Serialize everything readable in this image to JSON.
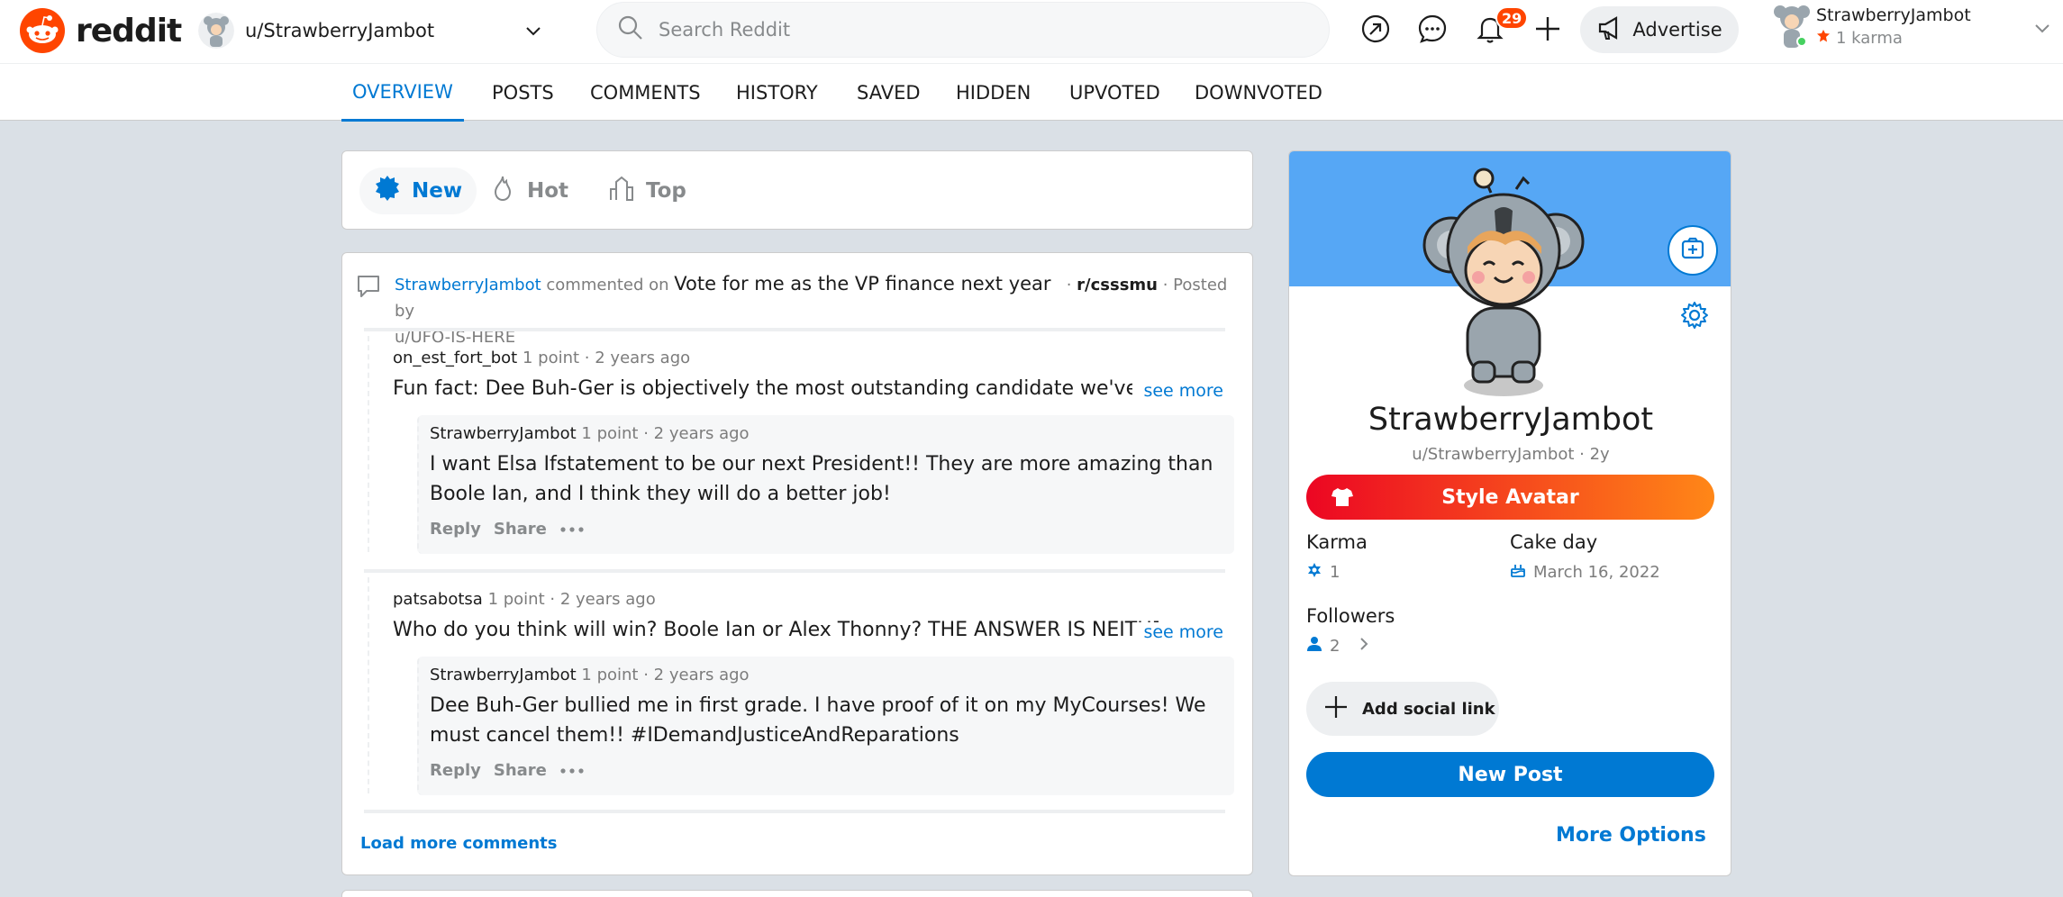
{
  "brand": {
    "wordmark": "reddit",
    "color": "#ff4500"
  },
  "context": {
    "label": "u/StrawberryJambot"
  },
  "search": {
    "placeholder": "Search Reddit"
  },
  "header": {
    "notifications_count": "29",
    "advertise_label": "Advertise"
  },
  "user": {
    "name": "StrawberryJambot",
    "karma": "1 karma"
  },
  "tabs": [
    "OVERVIEW",
    "POSTS",
    "COMMENTS",
    "HISTORY",
    "SAVED",
    "HIDDEN",
    "UPVOTED",
    "DOWNVOTED"
  ],
  "sort": {
    "new": "New",
    "hot": "Hot",
    "top": "Top"
  },
  "post": {
    "commenter": "StrawberryJambot",
    "action": "commented on",
    "title": "Vote for me as the VP finance next year",
    "subreddit": "r/csssmu",
    "posted_by": "· Posted by",
    "author": "u/UFO-IS-HERE"
  },
  "comments": [
    {
      "author": "on_est_fort_bot",
      "points": "1 point",
      "age": "· 2 years ago",
      "body": "Fun fact: Dee Buh-Ger is objectively the most outstanding candidate we've seen in years",
      "see_more": "see more",
      "reply": {
        "author": "StrawberryJambot",
        "points": "1 point",
        "age": "· 2 years ago",
        "body": "I want Elsa Ifstatement to be our next President!! They are more amazing than Boole Ian, and I think they will do a better job!",
        "reply_label": "Reply",
        "share_label": "Share"
      }
    },
    {
      "author": "patsabotsa",
      "points": "1 point",
      "age": "· 2 years ago",
      "body": "Who do you think will win? Boole Ian or Alex Thonny? THE ANSWER IS NEITHER! Only",
      "see_more": "see more",
      "reply": {
        "author": "StrawberryJambot",
        "points": "1 point",
        "age": "· 2 years ago",
        "body": "Dee Buh-Ger bullied me in first grade. I have proof of it on my MyCourses! We must cancel them!! #IDemandJusticeAndReparations",
        "reply_label": "Reply",
        "share_label": "Share"
      }
    }
  ],
  "load_more": "Load more comments",
  "profile": {
    "name": "StrawberryJambot",
    "handle": "u/StrawberryJambot · 2y",
    "style_avatar": "Style Avatar",
    "karma_label": "Karma",
    "karma_value": "1",
    "cakeday_label": "Cake day",
    "cakeday_value": "March 16, 2022",
    "followers_label": "Followers",
    "followers_value": "2",
    "add_social": "Add social link",
    "new_post": "New Post",
    "more_options": "More Options",
    "banner_color": "#56a7f5"
  }
}
